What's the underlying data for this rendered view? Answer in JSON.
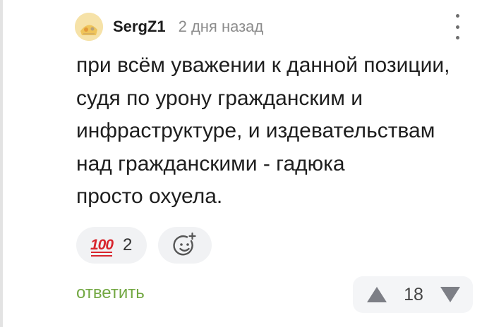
{
  "comment": {
    "author": "SergZ1",
    "timestamp": "2 дня назад",
    "text_lines": [
      "при всём уважении к данной позиции,",
      "судя по урону гражданским и",
      "инфраструктуре, и издевательствам",
      "над гражданскими - гадюка",
      "просто охуела."
    ],
    "reaction": {
      "emoji": "100",
      "count": "2"
    },
    "reply_label": "ответить",
    "rating": "18"
  },
  "icons": {
    "menu": "more-vertical-icon",
    "add_reaction": "smile-plus-icon",
    "upvote": "triangle-up-icon",
    "downvote": "triangle-down-icon"
  },
  "colors": {
    "reply_green": "#73a843",
    "reaction_red": "#d8252d",
    "text": "#1e1e1e",
    "muted": "#8c8c8c"
  }
}
